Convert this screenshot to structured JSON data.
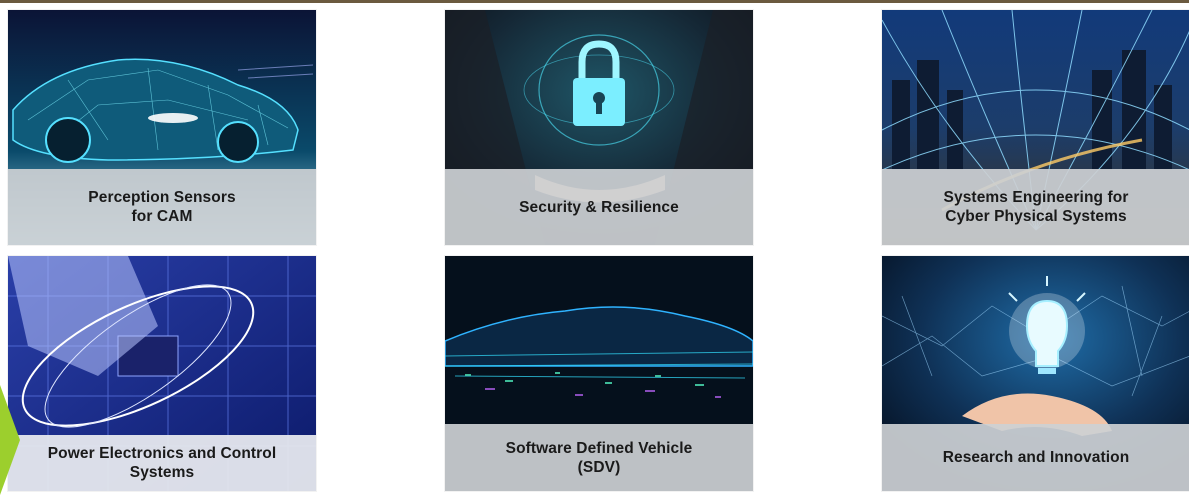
{
  "tiles": [
    {
      "label": "Perception Sensors\nfor CAM",
      "icon": "car-wireframe-icon"
    },
    {
      "label": "Security & Resilience",
      "icon": "padlock-icon"
    },
    {
      "label": "Systems Engineering for\nCyber Physical Systems",
      "icon": "city-network-icon"
    },
    {
      "label": "Power Electronics and Control\nSystems",
      "icon": "circuit-board-icon"
    },
    {
      "label": "Software Defined Vehicle\n(SDV)",
      "icon": "car-silhouette-icon"
    },
    {
      "label": "Research and Innovation",
      "icon": "lightbulb-icon"
    }
  ],
  "colors": {
    "top_bar": "#6b5a3f",
    "accent_arrow": "#9ccf2d",
    "caption_bg": "#cdd0d4"
  }
}
